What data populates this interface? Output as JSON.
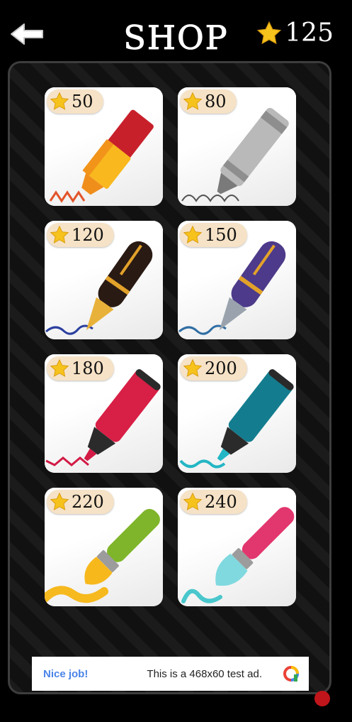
{
  "header": {
    "title": "SHOP",
    "balance": "125"
  },
  "items": [
    {
      "price": "50",
      "tool": "highlighter-yellow"
    },
    {
      "price": "80",
      "tool": "crayon-gray"
    },
    {
      "price": "120",
      "tool": "fountain-pen-black"
    },
    {
      "price": "150",
      "tool": "fountain-pen-purple"
    },
    {
      "price": "180",
      "tool": "marker-red"
    },
    {
      "price": "200",
      "tool": "marker-teal"
    },
    {
      "price": "220",
      "tool": "brush-green"
    },
    {
      "price": "240",
      "tool": "brush-pink"
    }
  ],
  "ad": {
    "headline": "Nice job!",
    "text": "This is a 468x60 test ad."
  },
  "colors": {
    "star": "#f6c21c",
    "badge": "#f6e2c6",
    "ad_headline": "#4a84e8"
  }
}
